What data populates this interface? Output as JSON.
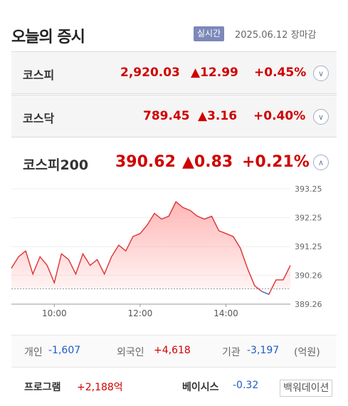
{
  "header": {
    "title": "오늘의 증시",
    "badge": "실시간",
    "date": "2025.06.12 장마감"
  },
  "indices": [
    {
      "name": "코스피",
      "value": "2,920.03",
      "change": "▲12.99",
      "percent": "+0.45%"
    },
    {
      "name": "코스닥",
      "value": "789.45",
      "change": "▲3.16",
      "percent": "+0.40%"
    }
  ],
  "expanded": {
    "name": "코스피200",
    "value": "390.62",
    "change": "▲0.83",
    "percent": "+0.21%"
  },
  "chart_data": {
    "type": "area",
    "x_ticks": [
      "10:00",
      "12:00",
      "14:00"
    ],
    "y_ticks": [
      "393.25",
      "392.25",
      "391.25",
      "390.26",
      "389.26"
    ],
    "ylim": [
      389.26,
      393.25
    ],
    "previous_close": 389.79,
    "colors": {
      "up_line": "#e03030",
      "up_fill": "#ffb3b3",
      "down_line": "#3b7be0",
      "baseline": "#999999"
    },
    "x": [
      "09:00",
      "09:10",
      "09:20",
      "09:30",
      "09:40",
      "09:50",
      "10:00",
      "10:10",
      "10:20",
      "10:30",
      "10:40",
      "10:50",
      "11:00",
      "11:10",
      "11:20",
      "11:30",
      "11:40",
      "11:50",
      "12:00",
      "12:10",
      "12:20",
      "12:30",
      "12:40",
      "12:50",
      "13:00",
      "13:10",
      "13:20",
      "13:30",
      "13:40",
      "13:50",
      "14:00",
      "14:10",
      "14:20",
      "14:30",
      "14:40",
      "14:50",
      "15:00",
      "15:10",
      "15:20",
      "15:30"
    ],
    "values": [
      390.5,
      390.9,
      391.1,
      390.3,
      390.9,
      390.6,
      390.0,
      391.0,
      390.8,
      390.3,
      391.0,
      390.6,
      390.8,
      390.3,
      390.9,
      391.3,
      391.1,
      391.6,
      391.7,
      392.0,
      392.4,
      392.2,
      392.3,
      392.8,
      392.6,
      392.5,
      392.3,
      392.2,
      392.3,
      391.8,
      391.7,
      391.6,
      391.2,
      390.5,
      389.9,
      389.7,
      389.6,
      390.1,
      390.1,
      390.6
    ]
  },
  "investors": {
    "individual_label": "개인",
    "individual_value": "-1,607",
    "foreign_label": "외국인",
    "foreign_value": "+4,618",
    "institution_label": "기관",
    "institution_value": "-3,197",
    "unit": "(억원)"
  },
  "program": {
    "label": "프로그램",
    "value": "+2,188억",
    "basis_label": "베이시스",
    "basis_value": "-0.32",
    "backwardation": "백워데이션"
  }
}
